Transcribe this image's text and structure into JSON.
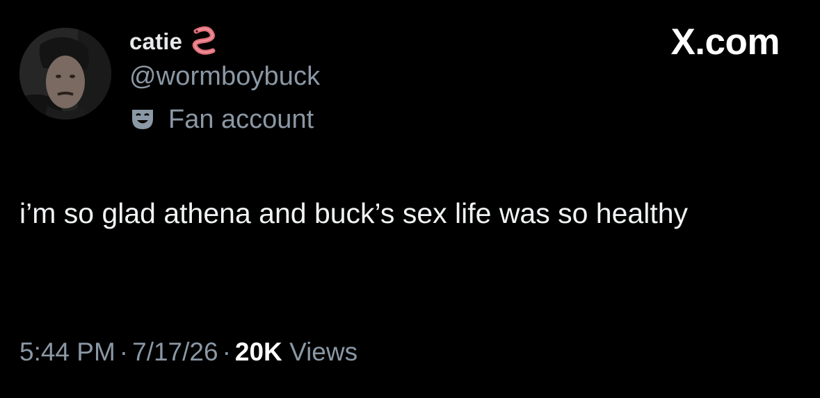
{
  "author": {
    "display_name": "catie",
    "handle": "@wormboybuck",
    "label": "Fan account",
    "name_emoji": "worm-emoji",
    "label_icon": "theater-mask-icon"
  },
  "watermark": "X.com",
  "tweet": {
    "text": "i’m so glad athena and buck’s sex life was so healthy"
  },
  "meta": {
    "time": "5:44 PM",
    "separator": "·",
    "date": "7/17/26",
    "views_count": "20K",
    "views_label": "Views"
  },
  "colors": {
    "background": "#000000",
    "primary_text": "#e7e9ea",
    "secondary_text": "#8b98a5",
    "emoji_worm": "#e2707a"
  }
}
